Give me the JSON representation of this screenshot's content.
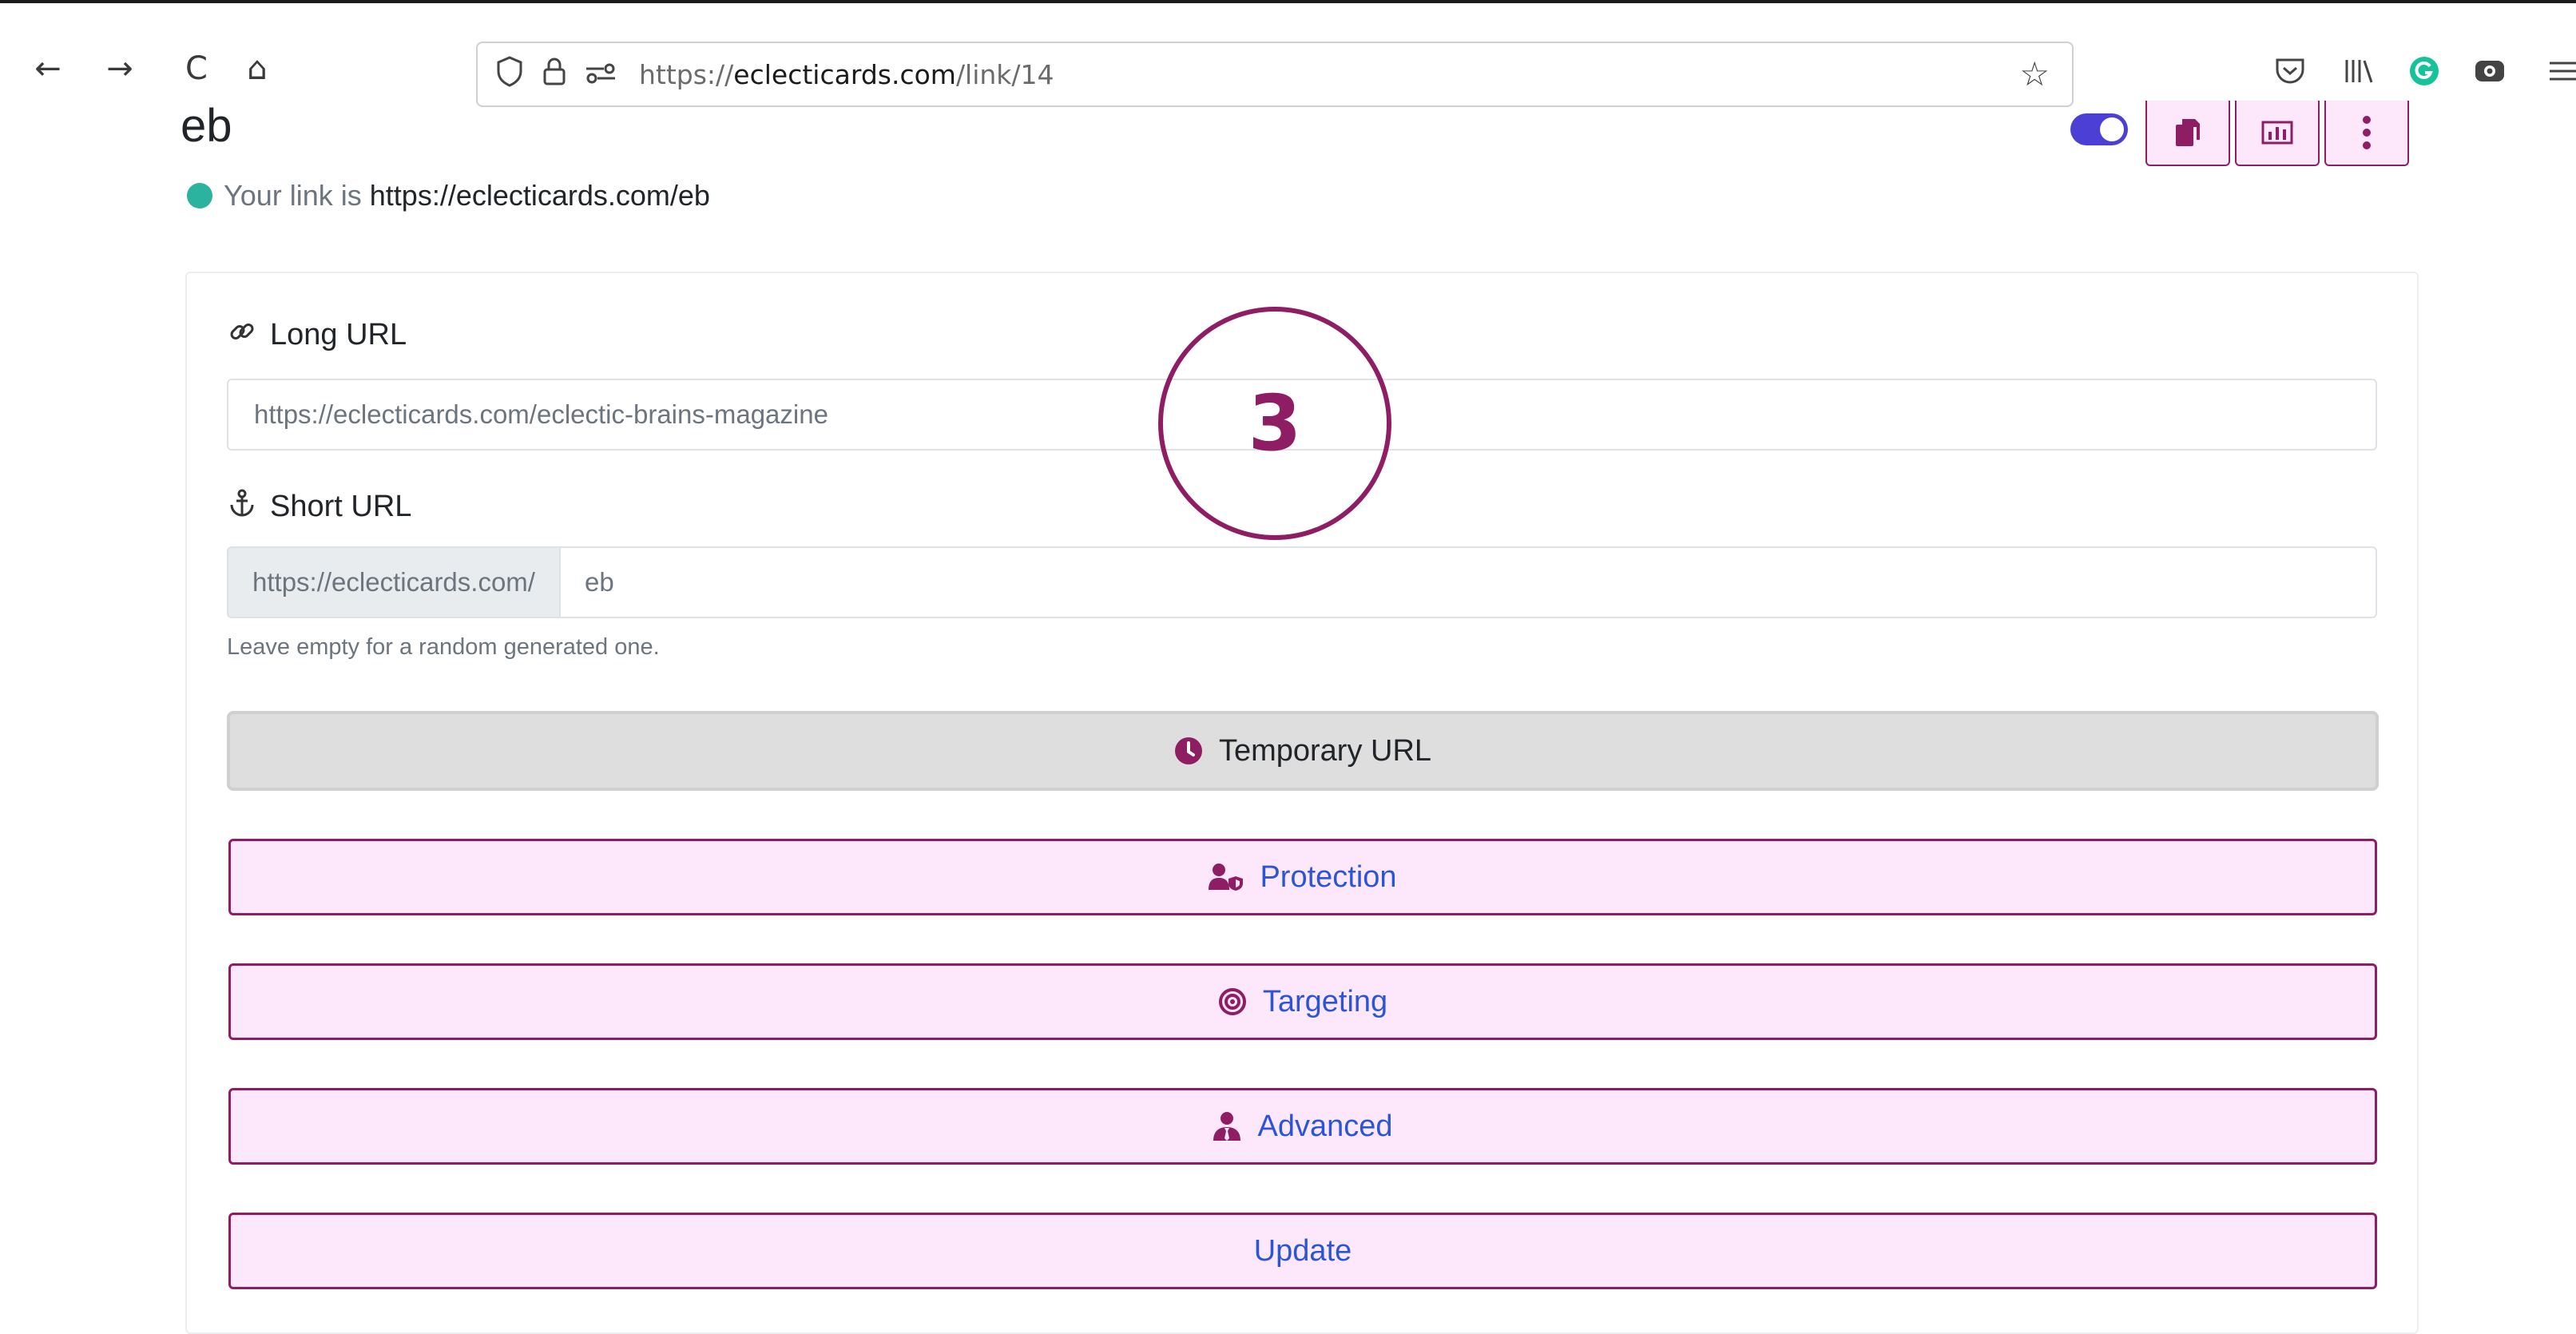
{
  "browser": {
    "back_icon": "←",
    "forward_icon": "→",
    "reload_icon": "C",
    "home_icon": "⌂",
    "url_prefix": "https://",
    "url_domain": "eclecticards.com",
    "url_path": "/link/14"
  },
  "header": {
    "title": "eb",
    "status_prefix": "Your link is",
    "status_link": "https://eclecticards.com/eb",
    "status_color": "#2bb3a0"
  },
  "form": {
    "long_url_label": "Long URL",
    "long_url_value": "https://eclecticards.com/eclectic-brains-magazine",
    "short_url_label": "Short URL",
    "short_url_prefix": "https://eclecticards.com/",
    "short_url_value": "eb",
    "short_url_help": "Leave empty for a random generated one."
  },
  "buttons": {
    "temporary": "Temporary URL",
    "protection": "Protection",
    "targeting": "Targeting",
    "advanced": "Advanced",
    "update": "Update"
  },
  "step_marker": "3",
  "colors": {
    "accent": "#8f1d64",
    "button_fill": "#fde8fb",
    "button_text": "#2b55d6",
    "toggle": "#4b3fd6"
  }
}
